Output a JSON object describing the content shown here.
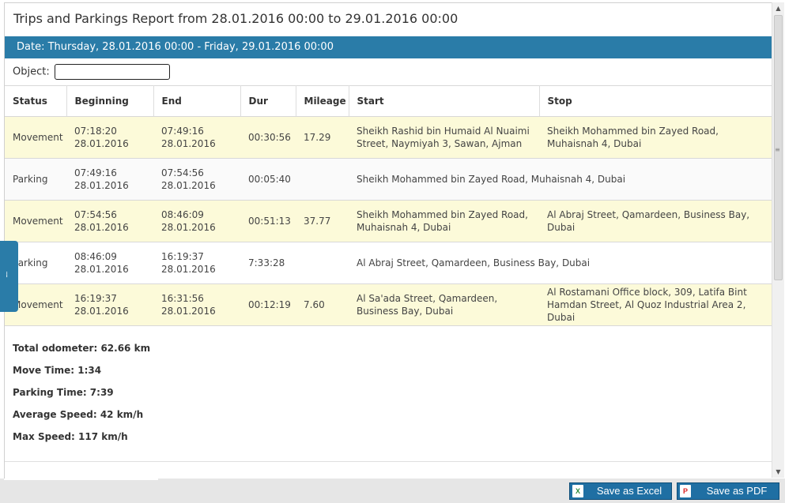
{
  "title": "Trips and Parkings Report from 28.01.2016 00:00 to 29.01.2016 00:00",
  "date_bar": "Date: Thursday, 28.01.2016 00:00 - Friday, 29.01.2016 00:00",
  "object": {
    "label": "Object:",
    "value": ""
  },
  "columns": [
    "Status",
    "Beginning",
    "End",
    "Dur",
    "Mileage",
    "Start",
    "Stop"
  ],
  "rows": [
    {
      "status": "Movement",
      "begin_time": "07:18:20",
      "begin_date": "28.01.2016",
      "end_time": "07:49:16",
      "end_date": "28.01.2016",
      "dur": "00:30:56",
      "mileage": "17.29",
      "start": "Sheikh Rashid bin Humaid Al Nuaimi Street, Naymiyah 3, Sawan, Ajman",
      "stop": "Sheikh Mohammed bin Zayed Road, Muhaisnah 4, Dubai"
    },
    {
      "status": "Parking",
      "begin_time": "07:49:16",
      "begin_date": "28.01.2016",
      "end_time": "07:54:56",
      "end_date": "28.01.2016",
      "dur": "00:05:40",
      "mileage": "",
      "start": "Sheikh Mohammed bin Zayed Road, Muhaisnah 4, Dubai",
      "stop": ""
    },
    {
      "status": "Movement",
      "begin_time": "07:54:56",
      "begin_date": "28.01.2016",
      "end_time": "08:46:09",
      "end_date": "28.01.2016",
      "dur": "00:51:13",
      "mileage": "37.77",
      "start": "Sheikh Mohammed bin Zayed Road, Muhaisnah 4, Dubai",
      "stop": "Al Abraj Street, Qamardeen, Business Bay, Dubai"
    },
    {
      "status": "Parking",
      "begin_time": "08:46:09",
      "begin_date": "28.01.2016",
      "end_time": "16:19:37",
      "end_date": "28.01.2016",
      "dur": "7:33:28",
      "mileage": "",
      "start": "Al Abraj Street, Qamardeen, Business Bay, Dubai",
      "stop": ""
    },
    {
      "status": "Movement",
      "begin_time": "16:19:37",
      "begin_date": "28.01.2016",
      "end_time": "16:31:56",
      "end_date": "28.01.2016",
      "dur": "00:12:19",
      "mileage": "7.60",
      "start": "Al Sa'ada Street, Qamardeen, Business Bay, Dubai",
      "stop": "Al Rostamani Office block, 309, Latifa Bint Hamdan Street, Al Quoz Industrial Area 2, Dubai"
    }
  ],
  "summary": {
    "total_odometer": "Total odometer: 62.66 km",
    "move_time": "Move Time: 1:34",
    "parking_time": "Parking Time: 7:39",
    "average_speed": "Average Speed: 42 km/h",
    "max_speed": "Max Speed: 117 km/h"
  },
  "buttons": {
    "excel": "Save as Excel",
    "pdf": "Save as PDF"
  },
  "colors": {
    "header_bar": "#2a7ca8",
    "movement_row": "#fcfad9",
    "button": "#1f6fa3"
  }
}
